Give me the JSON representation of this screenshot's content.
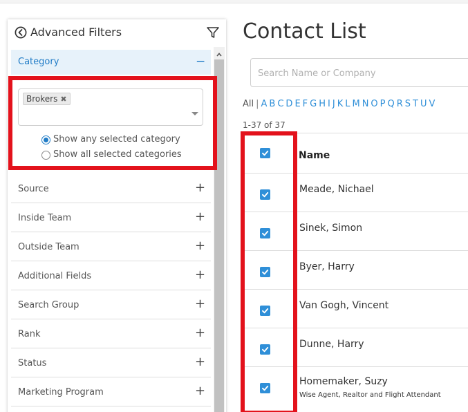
{
  "filters": {
    "title": "Advanced Filters",
    "category": {
      "label": "Category",
      "collapse_symbol": "−",
      "selected_chip": "Brokers",
      "chip_remove_symbol": "✖",
      "radio_any": "Show any selected category",
      "radio_all": "Show all selected categories",
      "radio_selected": "any"
    },
    "expand_symbol": "+",
    "sections": [
      {
        "label": "Source"
      },
      {
        "label": "Inside Team"
      },
      {
        "label": "Outside Team"
      },
      {
        "label": "Additional Fields"
      },
      {
        "label": "Search Group"
      },
      {
        "label": "Rank"
      },
      {
        "label": "Status"
      },
      {
        "label": "Marketing Program"
      }
    ]
  },
  "contacts": {
    "title": "Contact List",
    "search_placeholder": "Search Name or Company",
    "alpha_all": "All",
    "alpha_sep": "|",
    "alpha_letters": [
      "A",
      "B",
      "C",
      "D",
      "E",
      "F",
      "G",
      "H",
      "I",
      "J",
      "K",
      "L",
      "M",
      "N",
      "O",
      "P",
      "Q",
      "R",
      "S",
      "T",
      "U",
      "V"
    ],
    "count_text": "1-37 of 37",
    "column_name": "Name",
    "rows": [
      {
        "name": "Meade, Nichael",
        "sub": "",
        "checked": true
      },
      {
        "name": "Sinek, Simon",
        "sub": "",
        "checked": true
      },
      {
        "name": "Byer, Harry",
        "sub": "",
        "checked": true
      },
      {
        "name": "Van Gogh, Vincent",
        "sub": "",
        "checked": true
      },
      {
        "name": "Dunne, Harry",
        "sub": "",
        "checked": true
      },
      {
        "name": "Homemaker, Suzy",
        "sub": "Wise Agent, Realtor and Flight Attendant",
        "checked": true
      }
    ]
  },
  "colors": {
    "accent": "#1f7bc6",
    "link": "#2f8fd8",
    "highlight": "#e3121c",
    "category_bg": "#e7f2fa"
  }
}
